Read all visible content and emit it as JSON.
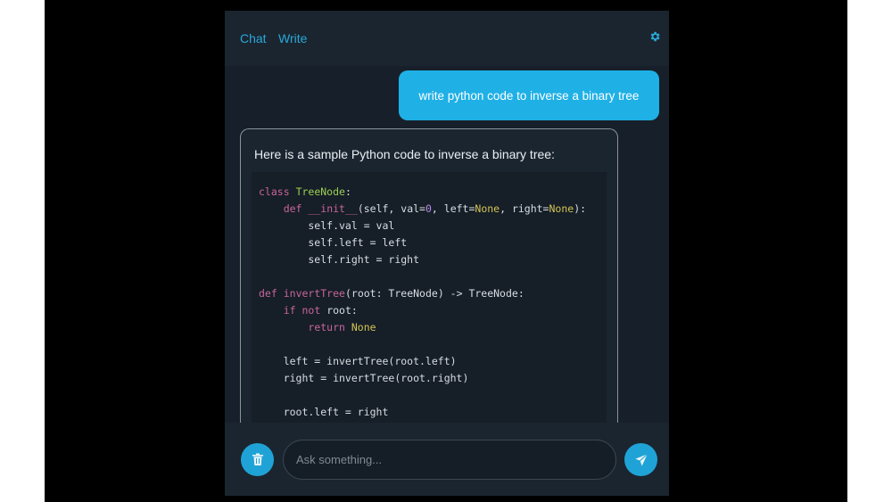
{
  "header": {
    "tabs": [
      {
        "label": "Chat",
        "active": true
      },
      {
        "label": "Write",
        "active": false
      }
    ],
    "settings_icon": "gear-icon"
  },
  "chat": {
    "user_message": "write python code to inverse a binary tree",
    "assistant_intro": "Here is a sample Python code to inverse a binary tree:",
    "code_lines": [
      "class TreeNode:",
      "    def __init__(self, val=0, left=None, right=None):",
      "        self.val = val",
      "        self.left = left",
      "        self.right = right",
      "",
      "def invertTree(root: TreeNode) -> TreeNode:",
      "    if not root:",
      "        return None",
      "",
      "    left = invertTree(root.left)",
      "    right = invertTree(root.right)",
      "",
      "    root.left = right"
    ]
  },
  "composer": {
    "placeholder": "Ask something...",
    "clear_icon": "trash-icon",
    "send_icon": "send-icon"
  },
  "colors": {
    "accent": "#1fb0e6",
    "background": "#17202a",
    "keyword": "#c7659c",
    "class_name": "#9ccf55",
    "none_const": "#d2c454",
    "number": "#b68ee8"
  }
}
